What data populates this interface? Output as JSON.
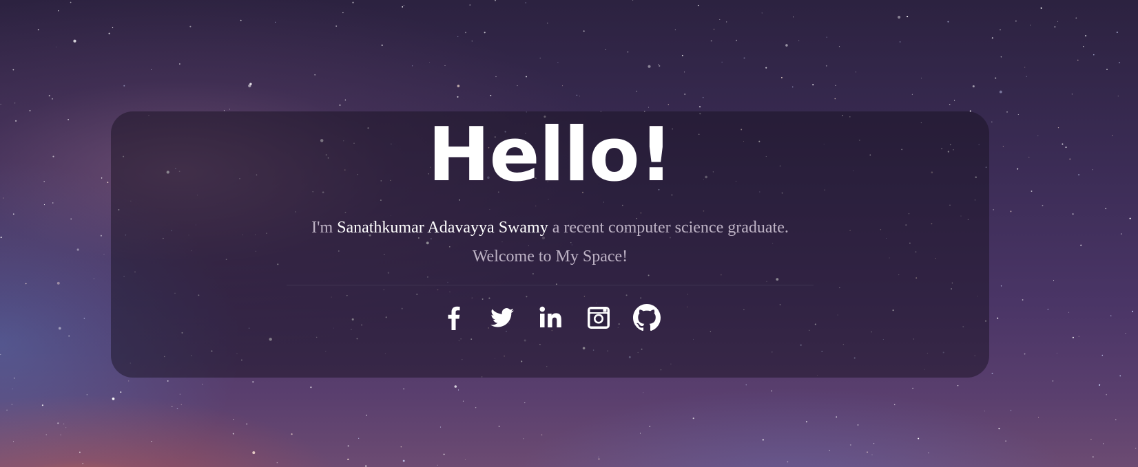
{
  "hero": {
    "title": "Hello!",
    "intro_prefix": "I'm ",
    "name": "Sanathkumar Adavayya Swamy",
    "intro_suffix": " a recent computer science graduate.",
    "welcome": "Welcome to My Space!"
  },
  "social_links": [
    {
      "icon": "facebook-icon"
    },
    {
      "icon": "twitter-icon"
    },
    {
      "icon": "linkedin-icon"
    },
    {
      "icon": "instagram-icon"
    },
    {
      "icon": "github-icon"
    }
  ],
  "colors": {
    "sky_top": "#2c2240",
    "sky_bottom": "#6c4b72",
    "card_background": "rgba(24,16,32,0.48)",
    "text_primary": "#ffffff",
    "text_muted": "#e1d7e6"
  }
}
